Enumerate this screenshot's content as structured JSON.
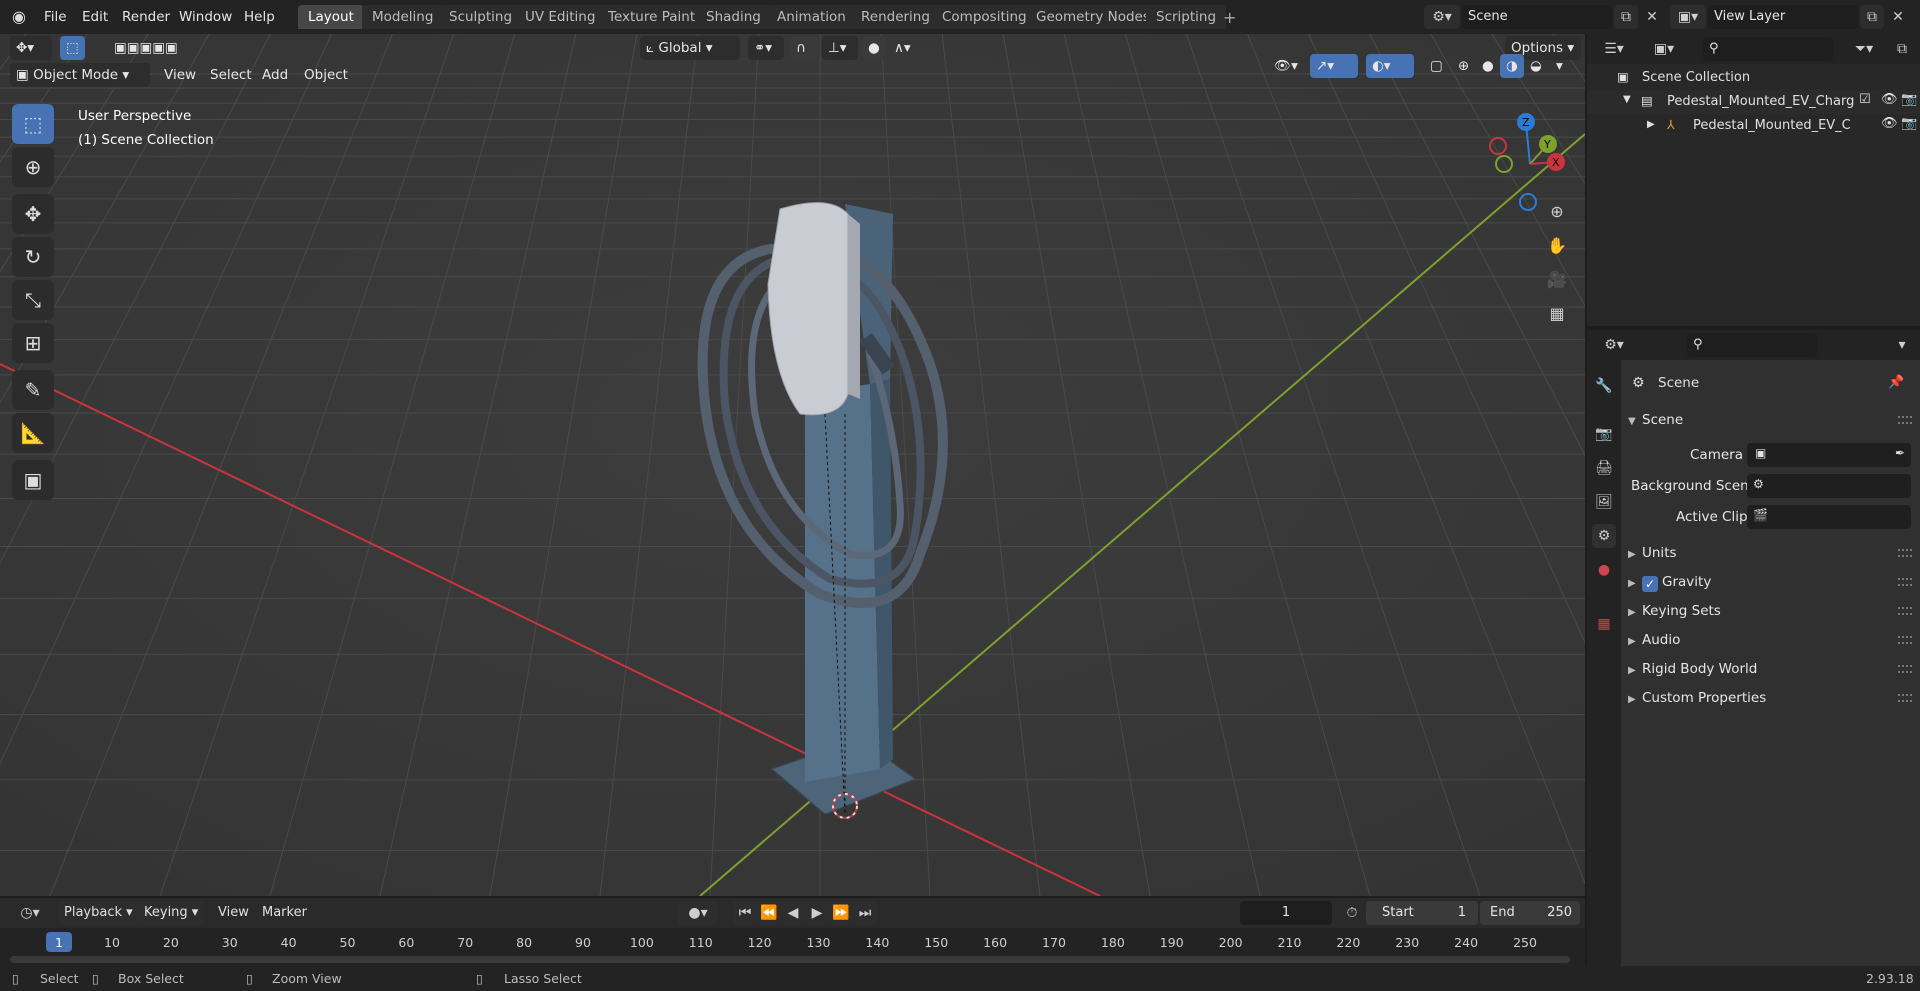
{
  "app": {
    "logo_icon": "blender-logo-icon"
  },
  "menus": [
    "File",
    "Edit",
    "Render",
    "Window",
    "Help"
  ],
  "workspaces": [
    "Layout",
    "Modeling",
    "Sculpting",
    "UV Editing",
    "Texture Paint",
    "Shading",
    "Animation",
    "Rendering",
    "Compositing",
    "Geometry Nodes",
    "Scripting"
  ],
  "scene_name": "Scene",
  "view_layer": "View Layer",
  "viewport": {
    "mode": "Object Mode",
    "menus": [
      "View",
      "Select",
      "Add",
      "Object"
    ],
    "transform_orientation": "Global",
    "options_label": "Options",
    "overlay_line1": "User Perspective",
    "overlay_line2": "(1) Scene Collection",
    "gizmo_axes": {
      "z": "Z",
      "y": "Y",
      "x": "X"
    }
  },
  "outliner": {
    "root": "Scene Collection",
    "items": [
      {
        "label": "Pedestal_Mounted_EV_Charg",
        "icon": "collection-icon"
      },
      {
        "label": "Pedestal_Mounted_EV_C",
        "icon": "armature-icon"
      }
    ]
  },
  "properties": {
    "context_title": "Scene",
    "section": "Scene",
    "fields": [
      {
        "label": "Camera",
        "value": ""
      },
      {
        "label": "Background Scene",
        "value": ""
      },
      {
        "label": "Active Clip",
        "value": ""
      }
    ],
    "panels": [
      "Units",
      "Gravity",
      "Keying Sets",
      "Audio",
      "Rigid Body World",
      "Custom Properties"
    ],
    "gravity_checked": true
  },
  "timeline": {
    "menus": [
      "Playback",
      "Keying",
      "View",
      "Marker"
    ],
    "current_frame": "1",
    "start_label": "Start",
    "start": "1",
    "end_label": "End",
    "end": "250",
    "ticks": [
      "1",
      "10",
      "20",
      "30",
      "40",
      "50",
      "60",
      "70",
      "80",
      "90",
      "100",
      "110",
      "120",
      "130",
      "140",
      "150",
      "160",
      "170",
      "180",
      "190",
      "200",
      "210",
      "220",
      "230",
      "240",
      "250"
    ]
  },
  "status": {
    "select": "Select",
    "box_select": "Box Select",
    "zoom_view": "Zoom View",
    "lasso_select": "Lasso Select",
    "version": "2.93.18"
  },
  "colors": {
    "accent": "#4772b3",
    "x_axis": "#c9343d",
    "y_axis": "#7ea12c",
    "z_axis": "#2a7dd7"
  }
}
